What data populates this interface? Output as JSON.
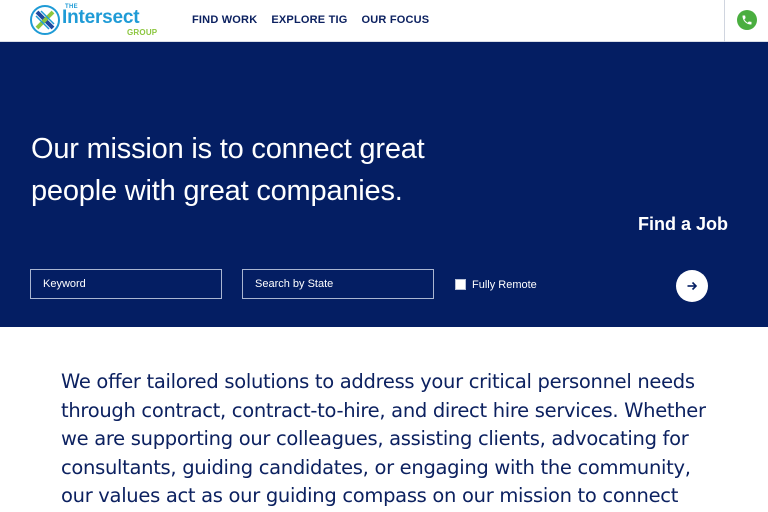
{
  "header": {
    "logo": {
      "the": "THE",
      "name": "Intersect",
      "group": "GROUP"
    },
    "nav": [
      {
        "label": "FIND WORK"
      },
      {
        "label": "EXPLORE TIG"
      },
      {
        "label": "OUR FOCUS"
      }
    ],
    "phone_icon": "phone-icon"
  },
  "hero": {
    "headline": "Our mission is to connect great people with great companies.",
    "find_job_title": "Find a Job",
    "keyword_placeholder": "Keyword",
    "state_placeholder": "Search by State",
    "fully_remote_label": "Fully Remote",
    "fully_remote_checked": false,
    "submit_icon": "arrow-right-icon"
  },
  "intro": {
    "text": "We offer tailored solutions to address your critical personnel needs through contract, contract-to-hire, and direct hire services. Whether we are supporting our colleagues, assisting clients, advocating for consultants, guiding candidates, or engaging with the community, our values act as our guiding compass on our mission to connect"
  },
  "colors": {
    "brand_navy": "#041e63",
    "brand_blue": "#1f9bd6",
    "brand_green": "#8cc63f",
    "text_navy": "#0c2160",
    "phone_green": "#4aae3f"
  }
}
